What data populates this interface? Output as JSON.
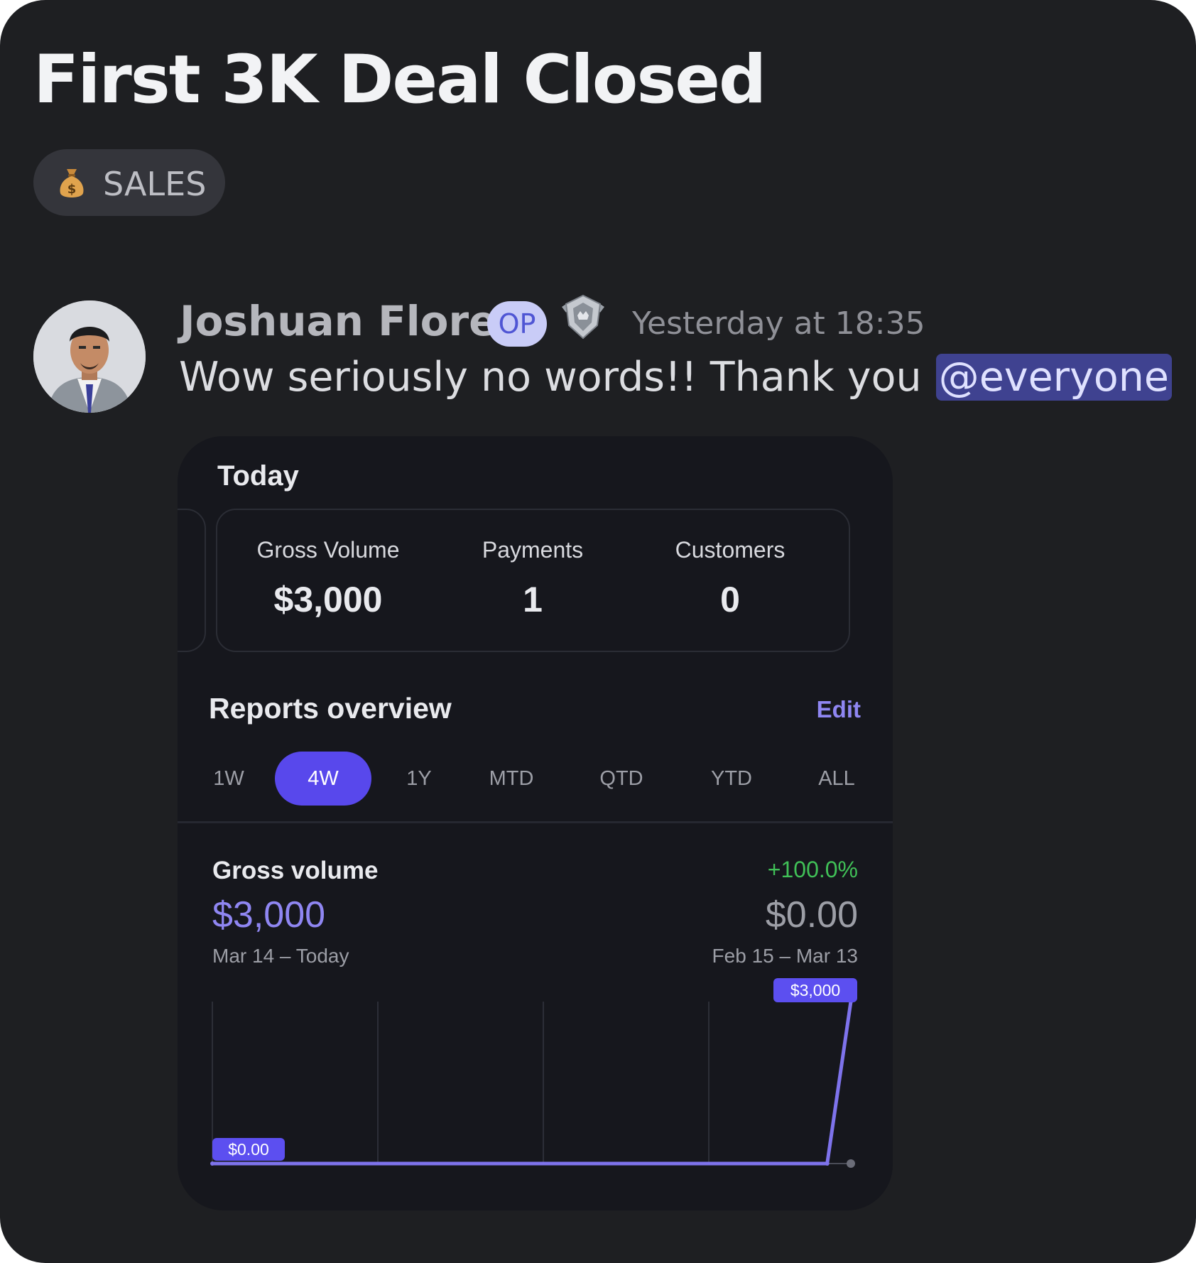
{
  "post": {
    "title": "First 3K Deal Closed",
    "tag": {
      "icon": "money-bag-icon",
      "label": "SALES"
    }
  },
  "message": {
    "author": "Joshuan Flores",
    "op_badge": "OP",
    "role_badge_icon": "shield-crest-icon",
    "timestamp": "Yesterday at 18:35",
    "text": "Wow seriously no words!! Thank you",
    "mention": "@everyone"
  },
  "attachment": {
    "today": {
      "heading": "Today",
      "stats": [
        {
          "label": "Gross Volume",
          "value": "$3,000"
        },
        {
          "label": "Payments",
          "value": "1"
        },
        {
          "label": "Customers",
          "value": "0"
        }
      ]
    },
    "reports": {
      "heading": "Reports overview",
      "edit_label": "Edit",
      "periods": [
        "1W",
        "4W",
        "1Y",
        "MTD",
        "QTD",
        "YTD",
        "ALL"
      ],
      "active_period": "4W"
    },
    "gross_volume": {
      "label": "Gross volume",
      "change": "+100.0%",
      "value": "$3,000",
      "previous_value": "$0.00",
      "range": "Mar 14 – Today",
      "previous_range": "Feb 15 – Mar 13"
    }
  },
  "colors": {
    "background": "#1e1f22",
    "accent": "#8f86f2",
    "active_pill": "#5848ec",
    "positive": "#40c057",
    "mention_bg": "#3f4290"
  },
  "chart_data": {
    "type": "line",
    "x_index": [
      0,
      26,
      27
    ],
    "values": [
      0,
      0,
      3000
    ],
    "point_labels": [
      "$0.00",
      "$3,000"
    ],
    "ylim": [
      0,
      3000
    ],
    "grid": "vertical",
    "title": "",
    "xlabel": "",
    "ylabel": ""
  }
}
